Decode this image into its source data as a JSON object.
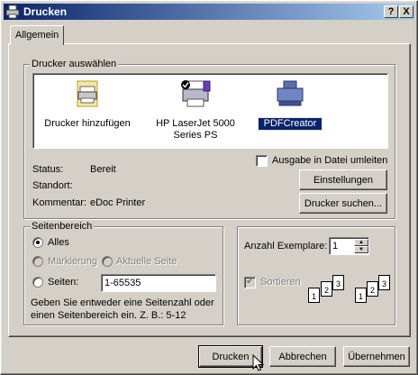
{
  "window": {
    "title": "Drucken",
    "help_button": "?",
    "close_button": "X"
  },
  "tabs": [
    {
      "label": "Allgemein"
    }
  ],
  "printer_group": {
    "legend": "Drucker auswählen",
    "printers": [
      {
        "label": "Drucker hinzufügen",
        "icon": "add-printer-icon"
      },
      {
        "label": "HP LaserJet 5000\nSeries PS",
        "icon": "default-printer-icon"
      },
      {
        "label": "PDFCreator",
        "icon": "printer-icon",
        "selected": true
      }
    ],
    "status_label": "Status:",
    "status_value": "Bereit",
    "location_label": "Standort:",
    "location_value": "",
    "comment_label": "Kommentar:",
    "comment_value": "eDoc Printer",
    "print_to_file_label": "Ausgabe in Datei umleiten",
    "preferences_button": "Einstellungen",
    "find_printer_button": "Drucker suchen..."
  },
  "page_range": {
    "legend": "Seitenbereich",
    "all_label": "Alles",
    "selection_label": "Markierung",
    "current_page_label": "Aktuelle Seite",
    "pages_label": "Seiten:",
    "pages_value": "1-65535",
    "hint": "Geben Sie entweder eine Seitenzahl oder einen Seitenbereich ein. Z. B.: 5-12"
  },
  "copies": {
    "label": "Anzahl Exemplare:",
    "value": "1",
    "collate_label": "Sortieren",
    "page_numbers": [
      "1",
      "2",
      "3"
    ]
  },
  "footer": {
    "print_button": "Drucken",
    "cancel_button": "Abbrechen",
    "apply_button": "Übernehmen"
  },
  "colors": {
    "titlebar_start": "#0a246a",
    "titlebar_end": "#a6caf0",
    "face": "#d4d0c8",
    "selection": "#0a246a"
  }
}
